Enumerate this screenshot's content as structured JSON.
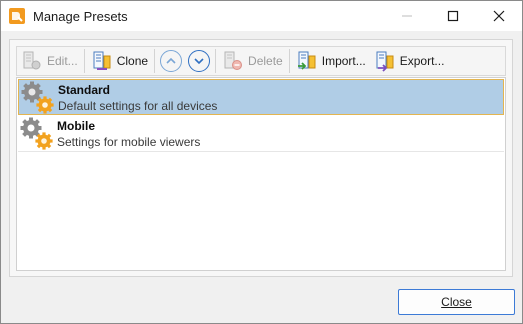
{
  "window": {
    "title": "Manage Presets",
    "icon": "app-logo-icon",
    "controls": {
      "minimize_icon": "minimize-icon",
      "maximize_icon": "maximize-icon",
      "close_icon": "close-icon"
    }
  },
  "toolbar": {
    "edit_label": "Edit...",
    "clone_label": "Clone",
    "move_up_icon": "arrow-up-circle-icon",
    "move_down_icon": "arrow-down-circle-icon",
    "delete_label": "Delete",
    "import_label": "Import...",
    "export_label": "Export..."
  },
  "presets": [
    {
      "name": "Standard",
      "description": "Default settings for all devices",
      "selected": true,
      "icon": "gears-icon"
    },
    {
      "name": "Mobile",
      "description": "Settings for mobile viewers",
      "selected": false,
      "icon": "gears-icon"
    }
  ],
  "footer": {
    "close_label": "Close"
  },
  "colors": {
    "selection_bg": "#b0cde6",
    "selection_border": "#e3b550",
    "accent_border": "#3c7ad6",
    "brand_orange": "#f29a1f"
  }
}
